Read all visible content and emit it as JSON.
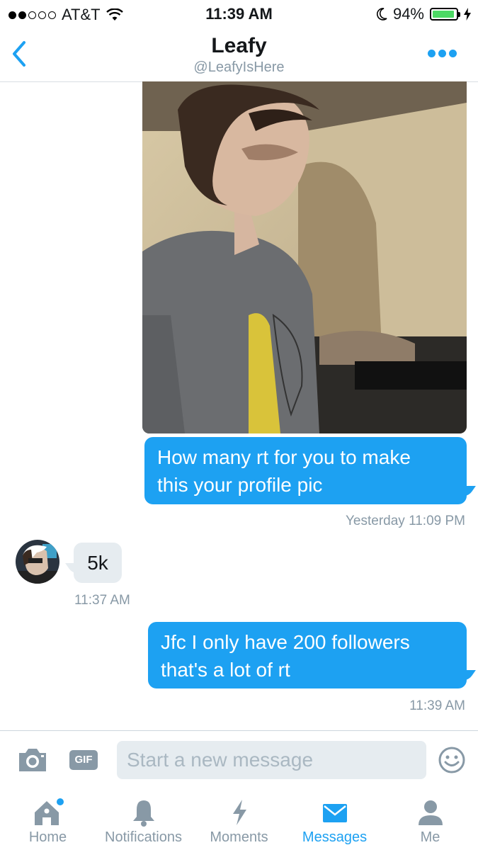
{
  "status_bar": {
    "carrier": "AT&T",
    "time": "11:39 AM",
    "battery": "94%"
  },
  "header": {
    "name": "Leafy",
    "handle": "@LeafyIsHere"
  },
  "messages": [
    {
      "text_line1": "How many rt for you to make",
      "text_line2": "this your profile pic",
      "time": "Yesterday 11:09 PM"
    },
    {
      "text": "5k",
      "time": "11:37 AM"
    },
    {
      "text_line1": "Jfc I only have 200 followers",
      "text_line2": "that's a lot of rt",
      "time": "11:39 AM"
    }
  ],
  "composer": {
    "gif_label": "GIF",
    "placeholder": "Start a new message"
  },
  "tabs": [
    {
      "label": "Home",
      "icon": "home-icon"
    },
    {
      "label": "Notifications",
      "icon": "bell-icon"
    },
    {
      "label": "Moments",
      "icon": "lightning-icon"
    },
    {
      "label": "Messages",
      "icon": "envelope-icon"
    },
    {
      "label": "Me",
      "icon": "person-icon"
    }
  ],
  "colors": {
    "accent": "#1da1f2",
    "inactive": "#8899a6",
    "incoming_bubble": "#e6ecf0",
    "battery": "#4cd964"
  }
}
